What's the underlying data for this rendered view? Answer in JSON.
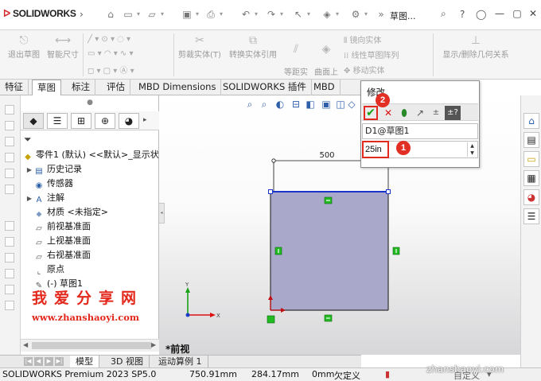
{
  "app": {
    "brand": "SOLIDWORKS",
    "document_title": "草图..."
  },
  "ribbon": {
    "exit_sketch": "退出草图",
    "smart_dim": "智能尺寸",
    "trim": "剪裁实体(T)",
    "convert": "转换实体引用",
    "offset": "等距实\n体",
    "surface_offset": "曲面上\n偏移",
    "mirror": "镜向实体",
    "linear_pattern": "线性草图阵列",
    "move": "移动实体",
    "show_delete": "显示/删除几何关系"
  },
  "tabs": [
    "特征",
    "草图",
    "标注",
    "评估",
    "MBD Dimensions",
    "SOLIDWORKS 插件",
    "MBD"
  ],
  "active_tab": "草图",
  "tree": {
    "root": "零件1 (默认) <<默认>_显示状",
    "items": [
      {
        "label": "历史记录",
        "expand": true
      },
      {
        "label": "传感器",
        "expand": false
      },
      {
        "label": "注解",
        "expand": true
      },
      {
        "label": "材质 <未指定>",
        "expand": false
      },
      {
        "label": "前视基准面",
        "expand": false
      },
      {
        "label": "上视基准面",
        "expand": false
      },
      {
        "label": "右视基准面",
        "expand": false
      },
      {
        "label": "原点",
        "expand": false
      },
      {
        "label": "(-) 草图1",
        "expand": false
      }
    ]
  },
  "watermark": {
    "cn": "我爱分享网",
    "url": "www.zhanshaoyi.com",
    "site": "zhanshaoyi.com"
  },
  "bottom_tabs": [
    "模型",
    "3D 视图",
    "运动算例 1"
  ],
  "statusbar": {
    "version": "SOLIDWORKS Premium 2023 SP5.0",
    "x": "750.91mm",
    "y": "284.17mm",
    "z": "0mm",
    "state": "欠定义",
    "custom": "自定义"
  },
  "viewport": {
    "dimension_text": "500",
    "view_label": "*前视",
    "axis_y": "Y",
    "axis_x": "X"
  },
  "modify_dialog": {
    "title": "修改",
    "dim_name": "D1@草图1",
    "value": "25in",
    "badge1": "1",
    "badge2": "2"
  },
  "colors": {
    "accent": "#e02a20",
    "sketch_fill": "#a9a8cb",
    "ok_green": "#14a114",
    "constraint_green": "#22bb22",
    "sketch_blue": "#1a33c8"
  }
}
